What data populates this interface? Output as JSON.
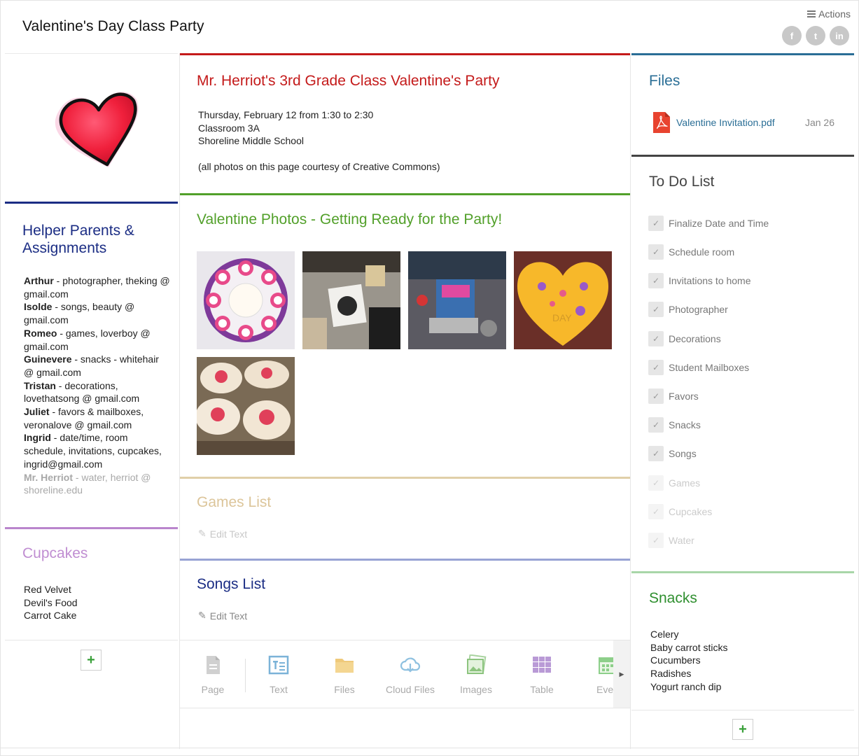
{
  "header": {
    "title": "Valentine's Day Class Party",
    "actions_label": "Actions",
    "social": [
      {
        "icon": "facebook-icon",
        "glyph": "f"
      },
      {
        "icon": "twitter-icon",
        "glyph": "t"
      },
      {
        "icon": "linkedin-icon",
        "glyph": "in"
      }
    ]
  },
  "left": {
    "helpers": {
      "title": "Helper Parents & Assignments",
      "entries": [
        {
          "name": "Arthur",
          "text": " - photographer, theking @ gmail.com",
          "faded": false
        },
        {
          "name": "Isolde",
          "text": " - songs, beauty @ gmail.com",
          "faded": false
        },
        {
          "name": "Romeo",
          "text": " - games, loverboy @ gmail.com",
          "faded": false
        },
        {
          "name": "Guinevere",
          "text": " - snacks - whitehair @ gmail.com",
          "faded": false
        },
        {
          "name": "Tristan",
          "text": " - decorations, lovethatsong @ gmail.com",
          "faded": false
        },
        {
          "name": "Juliet",
          "text": " - favors & mailboxes, veronalove @ gmail.com",
          "faded": false
        },
        {
          "name": "Ingrid",
          "text": " - date/time, room schedule, invitations, cupcakes, ingrid@gmail.com",
          "faded": false
        },
        {
          "name": "Mr. Herriot",
          "text": " - water, herriot @ shoreline.edu",
          "faded": true
        }
      ]
    },
    "cupcakes": {
      "title": "Cupcakes",
      "items": [
        "Red Velvet",
        "Devil's Food",
        "Carrot Cake"
      ]
    },
    "add_label": "+"
  },
  "middle": {
    "party": {
      "title": "Mr. Herriot's 3rd Grade Class Valentine's Party",
      "line1": "Thursday, February 12 from 1:30 to 2:30",
      "line2": "Classroom 3A",
      "line3": "Shoreline Middle School",
      "note": "(all photos on this page courtesy of Creative Commons)"
    },
    "photos": {
      "title": "Valentine Photos - Getting Ready for the Party!"
    },
    "games": {
      "title": "Games List",
      "edit_label": "Edit Text"
    },
    "songs": {
      "title": "Songs List",
      "edit_label": "Edit Text"
    },
    "toolbar": [
      {
        "label": "Page",
        "icon": "page-icon"
      },
      {
        "label": "Text",
        "icon": "text-icon"
      },
      {
        "label": "Files",
        "icon": "folder-icon"
      },
      {
        "label": "Cloud Files",
        "icon": "cloud-icon"
      },
      {
        "label": "Images",
        "icon": "images-icon"
      },
      {
        "label": "Table",
        "icon": "table-icon"
      },
      {
        "label": "Even",
        "icon": "calendar-icon"
      }
    ],
    "scroll_glyph": "▶"
  },
  "right": {
    "files": {
      "title": "Files",
      "items": [
        {
          "name": "Valentine Invitation.pdf",
          "date": "Jan 26",
          "icon": "pdf-icon"
        }
      ]
    },
    "todo": {
      "title": "To Do List",
      "items": [
        {
          "label": "Finalize Date and Time",
          "done": true
        },
        {
          "label": "Schedule room",
          "done": true
        },
        {
          "label": "Invitations to home",
          "done": true
        },
        {
          "label": "Photographer",
          "done": true
        },
        {
          "label": "Decorations",
          "done": true
        },
        {
          "label": "Student Mailboxes",
          "done": true
        },
        {
          "label": "Favors",
          "done": true
        },
        {
          "label": "Snacks",
          "done": true
        },
        {
          "label": "Songs",
          "done": true
        },
        {
          "label": "Games",
          "done": false
        },
        {
          "label": "Cupcakes",
          "done": false
        },
        {
          "label": "Water",
          "done": false
        }
      ]
    },
    "snacks": {
      "title": "Snacks",
      "items": [
        "Celery",
        "Baby carrot sticks",
        "Cucumbers",
        "Radishes",
        "Yogurt ranch dip"
      ]
    },
    "add_label": "+"
  },
  "colors": {
    "red_header": "#c41a1a",
    "green_header": "#52a02a",
    "navy_header": "#1b2d84",
    "file_link": "#2a6e96",
    "cupcake_purple": "#c08ed2"
  }
}
